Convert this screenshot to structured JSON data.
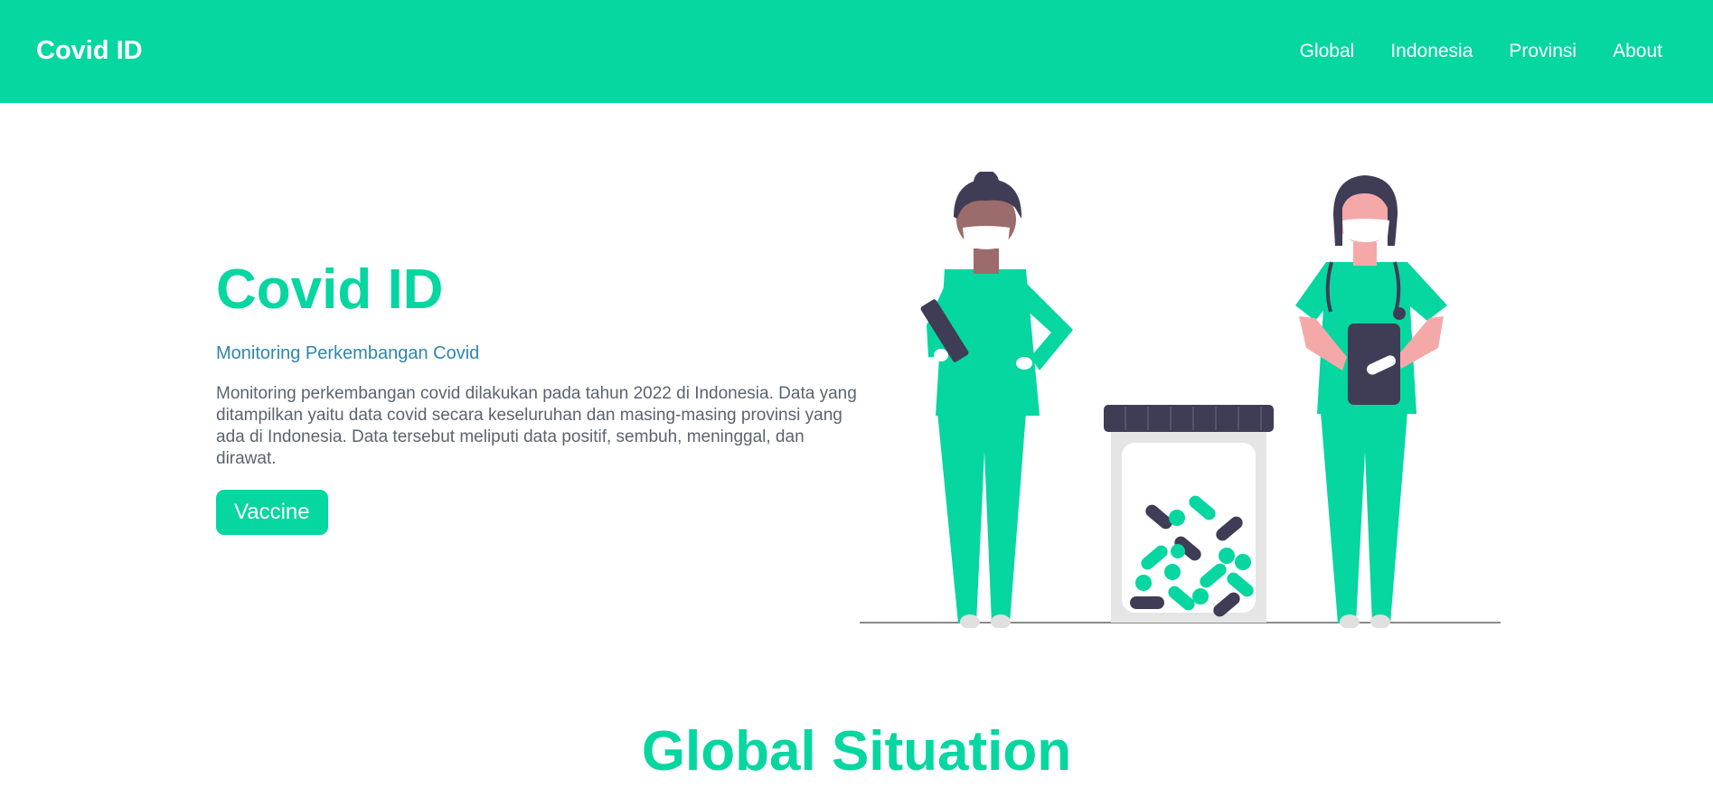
{
  "navbar": {
    "brand": "Covid ID",
    "links": [
      "Global",
      "Indonesia",
      "Provinsi",
      "About"
    ]
  },
  "hero": {
    "title": "Covid ID",
    "subtitle": "Monitoring Perkembangan Covid",
    "description": "Monitoring perkembangan covid dilakukan pada tahun 2022 di Indonesia. Data yang ditampilkan yaitu data covid secara keseluruhan dan masing-masing provinsi yang ada di Indonesia. Data tersebut meliputi data positif, sembuh, meninggal, dan dirawat.",
    "button_label": "Vaccine"
  },
  "section": {
    "title": "Global Situation"
  },
  "colors": {
    "accent": "#06d6a0",
    "subtitle": "#2e86ab",
    "text": "#5a6470",
    "dark": "#3f3d56"
  },
  "illustration": {
    "icon": "medical-staff-illustration"
  }
}
